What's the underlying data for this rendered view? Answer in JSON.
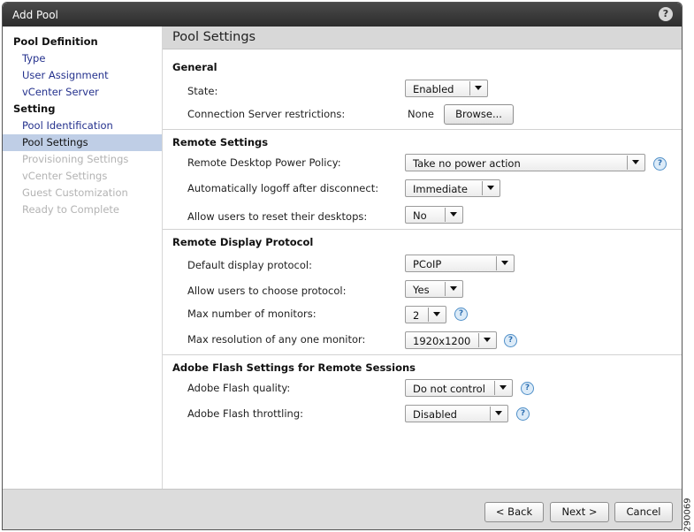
{
  "window": {
    "title": "Add Pool",
    "help_glyph": "?"
  },
  "sidebar": {
    "items": [
      {
        "label": "Pool Definition"
      },
      {
        "label": "Type"
      },
      {
        "label": "User Assignment"
      },
      {
        "label": "vCenter Server"
      },
      {
        "label": "Setting"
      },
      {
        "label": "Pool Identification"
      },
      {
        "label": "Pool Settings"
      },
      {
        "label": "Provisioning Settings"
      },
      {
        "label": "vCenter Settings"
      },
      {
        "label": "Guest Customization"
      },
      {
        "label": "Ready to Complete"
      }
    ]
  },
  "panel": {
    "title": "Pool Settings"
  },
  "general": {
    "title": "General",
    "state_label": "State:",
    "state_value": "Enabled",
    "conn_label": "Connection Server restrictions:",
    "conn_value": "None",
    "browse_label": "Browse..."
  },
  "remote": {
    "title": "Remote Settings",
    "power_label": "Remote Desktop Power Policy:",
    "power_value": "Take no power action",
    "logoff_label": "Automatically logoff after disconnect:",
    "logoff_value": "Immediate",
    "reset_label": "Allow users to reset their desktops:",
    "reset_value": "No"
  },
  "display": {
    "title": "Remote Display Protocol",
    "protocol_label": "Default display protocol:",
    "protocol_value": "PCoIP",
    "choose_label": "Allow users to choose protocol:",
    "choose_value": "Yes",
    "monitors_label": "Max number of monitors:",
    "monitors_value": "2",
    "resolution_label": "Max resolution of any one monitor:",
    "resolution_value": "1920x1200"
  },
  "flash": {
    "title": "Adobe Flash Settings for Remote Sessions",
    "quality_label": "Adobe Flash quality:",
    "quality_value": "Do not control",
    "throttle_label": "Adobe Flash throttling:",
    "throttle_value": "Disabled"
  },
  "footer": {
    "back_label": "< Back",
    "next_label": "Next >",
    "cancel_label": "Cancel"
  },
  "side_code": "290069",
  "icons": {
    "help": "help-icon",
    "dropdown": "chevron-down-icon"
  },
  "colors": {
    "active_nav": "#bfcee6",
    "link": "#24318d",
    "disabled": "#b3b3b3",
    "help_icon": "#4f8fc8"
  }
}
